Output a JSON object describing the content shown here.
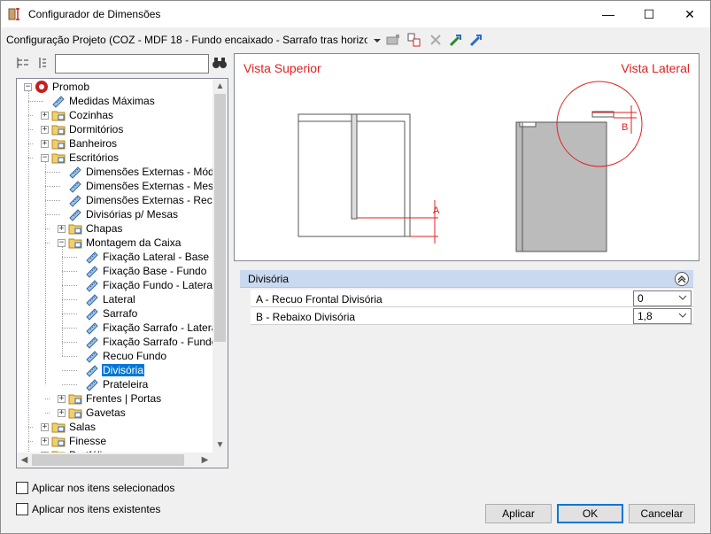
{
  "window": {
    "title": "Configurador de Dimensões",
    "minimize": "—",
    "maximize": "☐",
    "close": "✕"
  },
  "config": {
    "label": "Configuração Projeto (COZ - MDF 18 - Fundo encaixado - Sarrafo tras horizontal)"
  },
  "search": {
    "value": "",
    "placeholder": ""
  },
  "tree": {
    "items": [
      {
        "label": "Promob",
        "expander": "−"
      },
      {
        "label": "Medidas Máximas"
      },
      {
        "label": "Cozinhas",
        "expander": "+"
      },
      {
        "label": "Dormitórios",
        "expander": "+"
      },
      {
        "label": "Banheiros",
        "expander": "+"
      },
      {
        "label": "Escritórios",
        "expander": "−"
      },
      {
        "label": "Dimensões Externas - Módulos"
      },
      {
        "label": "Dimensões Externas - Mesas"
      },
      {
        "label": "Dimensões Externas - Recepção"
      },
      {
        "label": "Divisórias p/ Mesas"
      },
      {
        "label": "Chapas",
        "expander": "+"
      },
      {
        "label": "Montagem da Caixa",
        "expander": "−"
      },
      {
        "label": "Fixação Lateral - Base"
      },
      {
        "label": "Fixação Base - Fundo"
      },
      {
        "label": "Fixação Fundo - Lateral"
      },
      {
        "label": "Lateral"
      },
      {
        "label": "Sarrafo"
      },
      {
        "label": "Fixação Sarrafo - Lateral"
      },
      {
        "label": "Fixação Sarrafo - Fundo"
      },
      {
        "label": "Recuo Fundo"
      },
      {
        "label": "Divisória"
      },
      {
        "label": "Prateleira"
      },
      {
        "label": "Frentes | Portas",
        "expander": "+"
      },
      {
        "label": "Gavetas",
        "expander": "+"
      },
      {
        "label": "Salas",
        "expander": "+"
      },
      {
        "label": "Finesse",
        "expander": "+"
      },
      {
        "label": "Portfólio",
        "expander": "+"
      }
    ]
  },
  "preview": {
    "top_view": "Vista Superior",
    "side_view": "Vista Lateral",
    "marker_a": "A",
    "marker_b": "B",
    "accent": "#e02020"
  },
  "properties": {
    "group": "Divisória",
    "collapse_icon": "«",
    "rows": [
      {
        "name": "A - Recuo Frontal Divisória",
        "value": "0"
      },
      {
        "name": "B - Rebaixo Divisória",
        "value": "1,8"
      }
    ]
  },
  "options": {
    "apply_selected": "Aplicar nos itens selecionados",
    "apply_existing": "Aplicar nos itens existentes"
  },
  "buttons": {
    "apply": "Aplicar",
    "ok": "OK",
    "cancel": "Cancelar"
  }
}
